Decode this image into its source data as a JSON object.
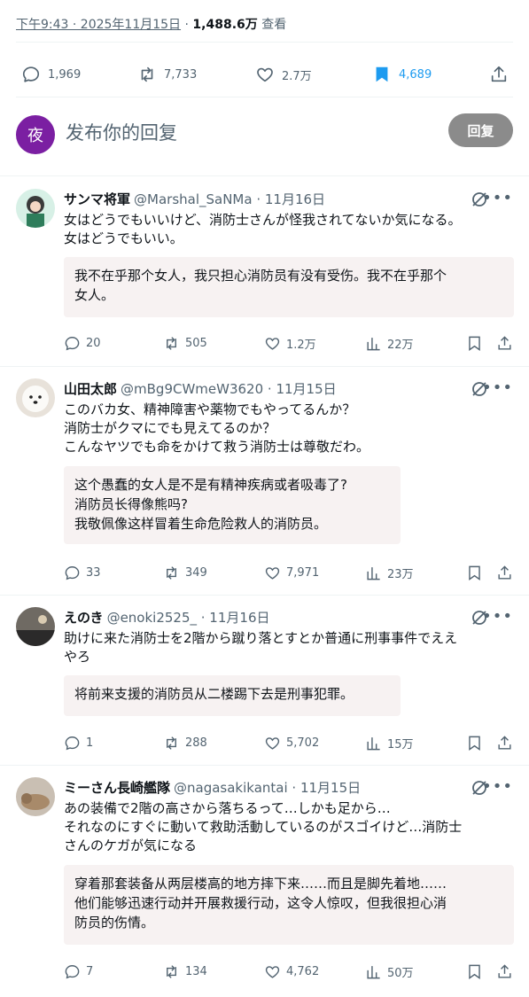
{
  "meta": {
    "time": "下午9:43 · 2025年11月15日",
    "dot": "·",
    "views_count": "1,488.6万",
    "views_label": "查看"
  },
  "stats": {
    "replies": "1,969",
    "reposts": "7,733",
    "likes": "2.7万",
    "bookmarks": "4,689"
  },
  "reply_box": {
    "avatar_letter": "夜",
    "placeholder": "发布你的回复",
    "button": "回复"
  },
  "colors": {
    "accent": "#1d9bf0",
    "reply_avatar": "#7b1fa2",
    "reply_button": "#8b8b8b",
    "translation_bg": "#f7f2f2"
  },
  "replies": [
    {
      "name": "サンマ将軍",
      "handle": "@Marshal_SaNMa · 11月16日",
      "text": "女はどうでもいいけど、消防士さんが怪我されてないか気になる。\n女はどうでもいい。",
      "translation": "我不在乎那个女人，我只担心消防员有没有受伤。我不在乎那个\n女人。",
      "replies": "20",
      "reposts": "505",
      "likes": "1.2万",
      "views": "22万"
    },
    {
      "name": "山田太郎",
      "handle": "@mBg9CWmeW3620 · 11月15日",
      "text": "このバカ女、精神障害や薬物でもやってるんか？\n消防士がクマにでも見えてるのか？\nこんなヤツでも命をかけて救う消防士は尊敬だわ。",
      "translation": "这个愚蠢的女人是不是有精神疾病或者吸毒了?\n消防员长得像熊吗?\n我敬佩像这样冒着生命危险救人的消防员。",
      "replies": "33",
      "reposts": "349",
      "likes": "7,971",
      "views": "23万"
    },
    {
      "name": "えのき",
      "handle": "@enoki2525_ · 11月16日",
      "text": "助けに来た消防士を2階から蹴り落とすとか普通に刑事事件でええ\nやろ",
      "translation": "将前来支援的消防员从二楼踢下去是刑事犯罪。",
      "replies": "1",
      "reposts": "288",
      "likes": "5,702",
      "views": "15万"
    },
    {
      "name": "ミーさん長崎艦隊",
      "handle": "@nagasakikantai · 11月15日",
      "text": "あの装備で2階の高さから落ちるって…しかも足から…\nそれなのにすぐに動いて救助活動しているのがスゴイけど…消防士\nさんのケガが気になる",
      "translation": "穿着那套装备从两层楼高的地方摔下来……而且是脚先着地……\n他们能够迅速行动并开展救援行动，这令人惊叹，但我很担心消\n防员的伤情。",
      "replies": "7",
      "reposts": "134",
      "likes": "4,762",
      "views": "50万"
    }
  ]
}
